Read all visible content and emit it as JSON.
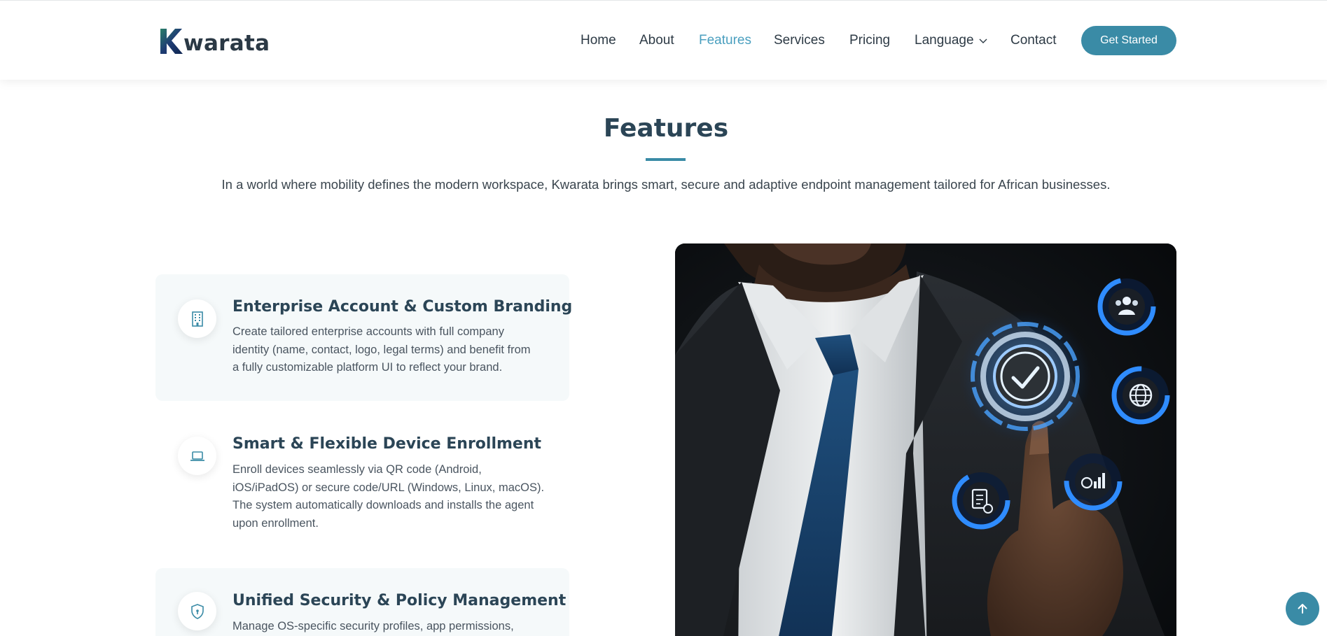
{
  "header": {
    "logo": {
      "text": "warata",
      "mark_letter": "K"
    },
    "nav": [
      {
        "label": "Home"
      },
      {
        "label": "About"
      },
      {
        "label": "Features",
        "active": true
      },
      {
        "label": "Services"
      },
      {
        "label": "Pricing"
      },
      {
        "label": "Language",
        "has_dropdown": true
      },
      {
        "label": "Contact"
      }
    ],
    "cta_label": "Get Started"
  },
  "features_section": {
    "title": "Features",
    "intro": "In a world where mobility defines the modern workspace, Kwarata brings smart, secure and adaptive endpoint management tailored for African businesses.",
    "items": [
      {
        "icon": "building-icon",
        "title": "Enterprise Account & Custom Branding",
        "desc_lines": [
          "Create tailored enterprise accounts with full company",
          "identity (name, contact, logo, legal terms) and benefit from",
          "a fully customizable platform UI to reflect your brand."
        ]
      },
      {
        "icon": "laptop-icon",
        "title": "Smart & Flexible Device Enrollment",
        "desc_lines": [
          "Enroll devices seamlessly via QR code (Android,",
          "iOS/iPadOS) or secure code/URL (Windows, Linux, macOS).",
          "The system automatically downloads and installs the agent",
          "upon enrollment."
        ]
      },
      {
        "icon": "shield-icon",
        "title": "Unified Security & Policy Management",
        "desc_lines": [
          "Manage OS-specific security profiles, app permissions,"
        ]
      }
    ]
  },
  "colors": {
    "accent": "#3a8ba6",
    "active_nav": "#4a9fbf",
    "heading": "#2b4556",
    "card_bg": "#f5f9fa"
  },
  "scroll_to_top_icon": "arrow-up-icon"
}
